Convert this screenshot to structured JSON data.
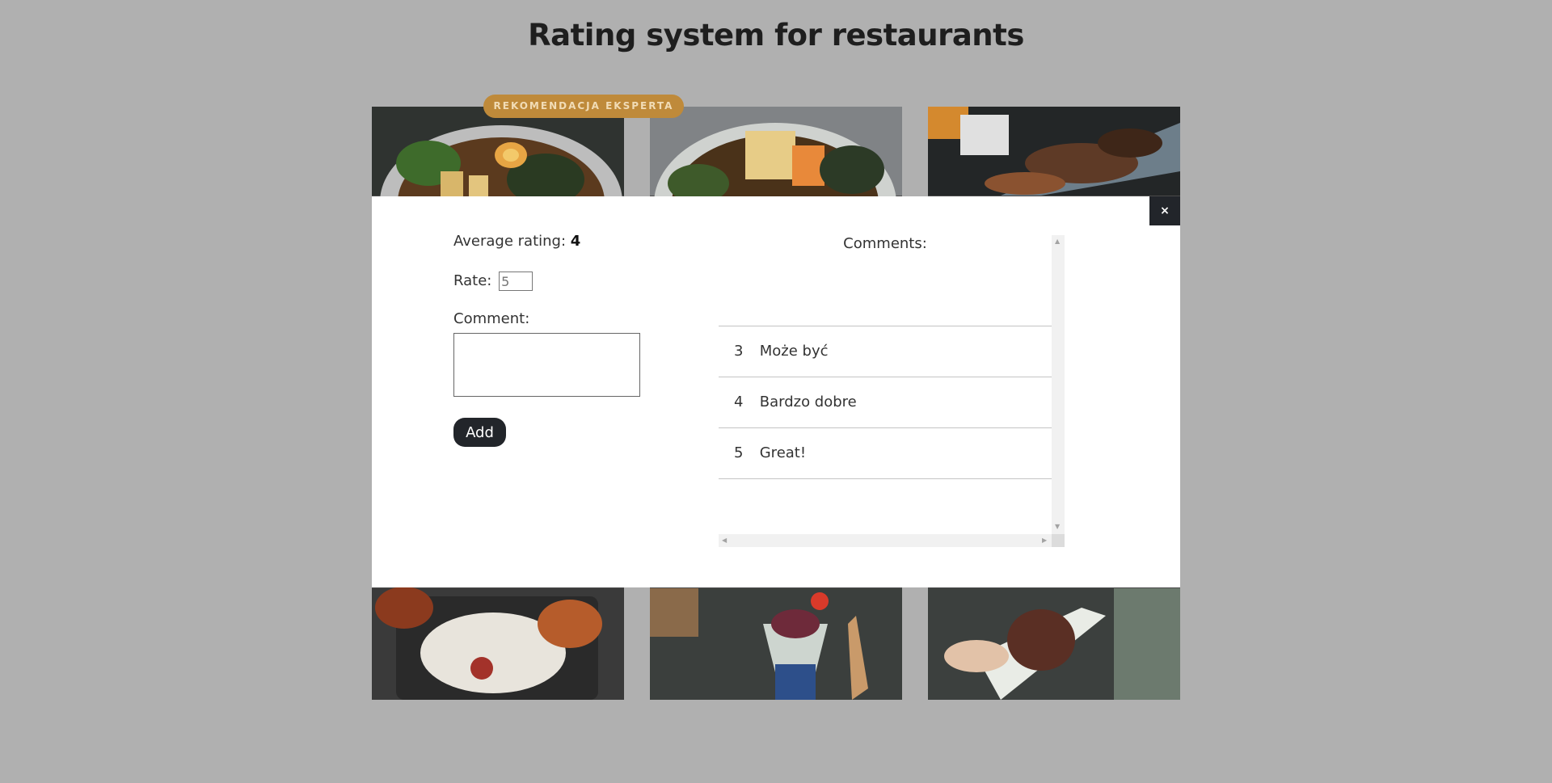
{
  "page": {
    "title": "Rating system for restaurants",
    "badge": "REKOMENDACJA EKSPERTA"
  },
  "gallery": {
    "tiles": [
      {
        "name": "ramen-bowl-egg"
      },
      {
        "name": "ramen-bowl-tofu"
      },
      {
        "name": "skewers-platter"
      },
      {
        "name": "bento-box"
      },
      {
        "name": "dessert-cup"
      },
      {
        "name": "dessert-plate"
      }
    ]
  },
  "modal": {
    "close_label": "×",
    "average_label": "Average rating:",
    "average_value": "4",
    "rate_label": "Rate:",
    "rate_placeholder": "5",
    "comment_label": "Comment:",
    "add_label": "Add",
    "comments_title": "Comments:",
    "comments": [
      {
        "rating": "3",
        "text": "Może być"
      },
      {
        "rating": "4",
        "text": "Bardzo dobre"
      },
      {
        "rating": "5",
        "text": "Great!"
      }
    ]
  }
}
